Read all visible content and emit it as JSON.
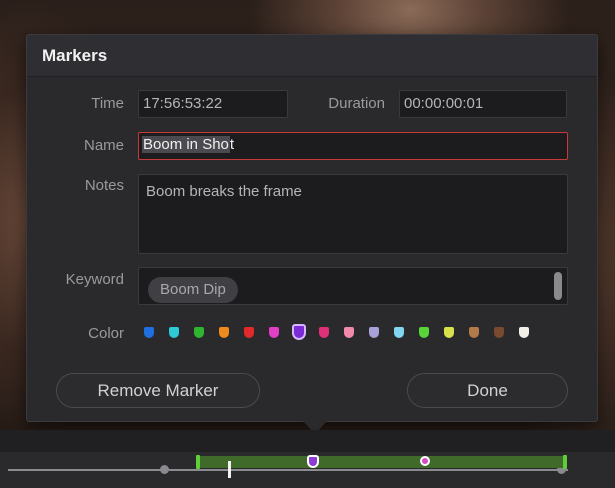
{
  "dialog": {
    "title": "Markers",
    "time_label": "Time",
    "time_value": "17:56:53:22",
    "duration_label": "Duration",
    "duration_value": "00:00:00:01",
    "name_label": "Name",
    "name_value_selected": "Boom in Sho",
    "name_value_rest": "t",
    "notes_label": "Notes",
    "notes_value": "Boom breaks the frame",
    "keyword_label": "Keyword",
    "keyword_chip": "Boom Dip",
    "color_label": "Color",
    "colors": [
      "#1e6fe0",
      "#2ec9d6",
      "#2fb52f",
      "#f08a1e",
      "#e22a2a",
      "#e23ec8",
      "#8a2be2",
      "#e0307a",
      "#f08aa8",
      "#a8a0d8",
      "#7fd6ee",
      "#56d438",
      "#d8e04a",
      "#b07a4a",
      "#7a4a2e",
      "#f2efe8"
    ],
    "selected_color": "#8a2be2",
    "remove_button": "Remove Marker",
    "done_button": "Done"
  },
  "timeline": {
    "clip_color": "#3f6a2a",
    "marker_colors": [
      "#8a2be2",
      "#e23ec8"
    ]
  }
}
